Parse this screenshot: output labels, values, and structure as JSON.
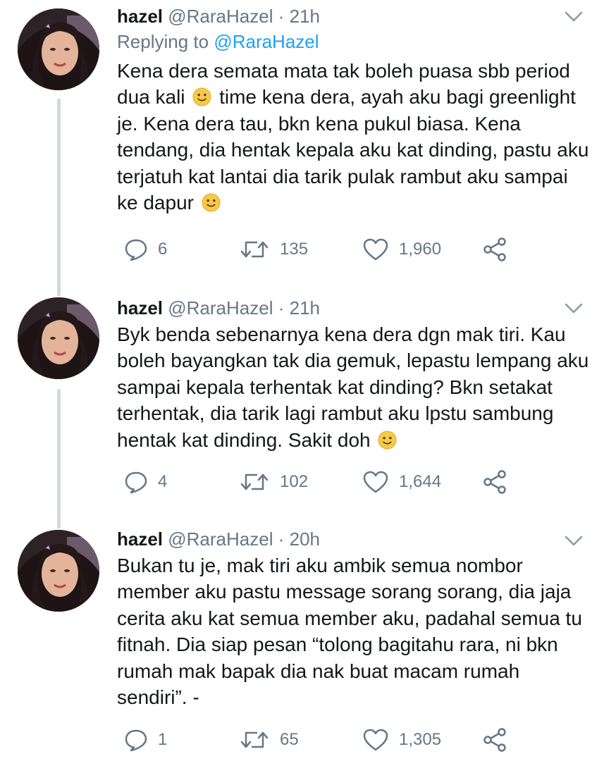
{
  "tweets": [
    {
      "name": "hazel",
      "handle": "@RaraHazel",
      "separator": "·",
      "time": "21h",
      "replying_prefix": "Replying to",
      "replying_to": "@RaraHazel",
      "text_parts": [
        "Kena dera semata mata tak boleh puasa sbb period dua kali",
        "time kena dera, ayah aku bagi greenlight je. Kena dera tau, bkn kena pukul biasa. Kena tendang, dia hentak kepala aku kat dinding, pastu aku terjatuh kat lantai dia tarik pulak rambut aku sampai ke dapur"
      ],
      "replies": "6",
      "retweets": "135",
      "likes": "1,960"
    },
    {
      "name": "hazel",
      "handle": "@RaraHazel",
      "separator": "·",
      "time": "21h",
      "text_parts": [
        "Byk benda sebenarnya kena dera dgn mak tiri. Kau boleh bayangkan tak dia gemuk, lepastu lempang aku sampai kepala terhentak kat dinding? Bkn setakat terhentak, dia tarik lagi rambut aku lpstu sambung hentak kat dinding. Sakit doh"
      ],
      "replies": "4",
      "retweets": "102",
      "likes": "1,644"
    },
    {
      "name": "hazel",
      "handle": "@RaraHazel",
      "separator": "·",
      "time": "20h",
      "text_parts": [
        "Bukan tu je, mak tiri aku ambik semua nombor member aku pastu message sorang sorang, dia jaja cerita aku kat semua member aku, padahal semua tu fitnah. Dia siap pesan “tolong bagitahu rara, ni bkn rumah mak bapak dia nak buat macam rumah sendiri”. -"
      ],
      "replies": "1",
      "retweets": "65",
      "likes": "1,305"
    }
  ],
  "icons": {
    "reply": "reply-icon",
    "retweet": "retweet-icon",
    "like": "heart-icon",
    "share": "share-icon",
    "caret": "chevron-down-icon",
    "emoji": "slightly-smiling-face-emoji"
  },
  "colors": {
    "text": "#14171a",
    "secondary": "#657786",
    "link": "#1da1f2",
    "thread_line": "#cfd9de",
    "emoji": "#f7c948"
  }
}
